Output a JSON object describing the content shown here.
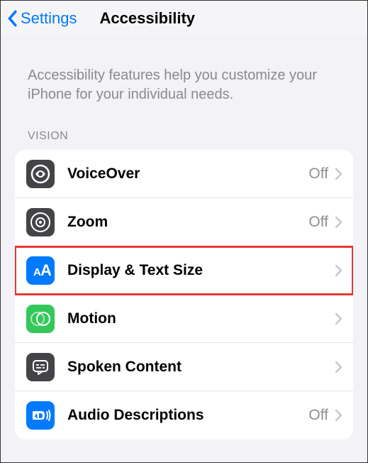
{
  "nav": {
    "back_label": "Settings",
    "title": "Accessibility"
  },
  "intro": "Accessibility features help you customize your iPhone for your individual needs.",
  "section": {
    "header": "VISION",
    "rows": [
      {
        "label": "VoiceOver",
        "value": "Off"
      },
      {
        "label": "Zoom",
        "value": "Off"
      },
      {
        "label": "Display & Text Size",
        "value": ""
      },
      {
        "label": "Motion",
        "value": ""
      },
      {
        "label": "Spoken Content",
        "value": ""
      },
      {
        "label": "Audio Descriptions",
        "value": "Off"
      }
    ]
  }
}
